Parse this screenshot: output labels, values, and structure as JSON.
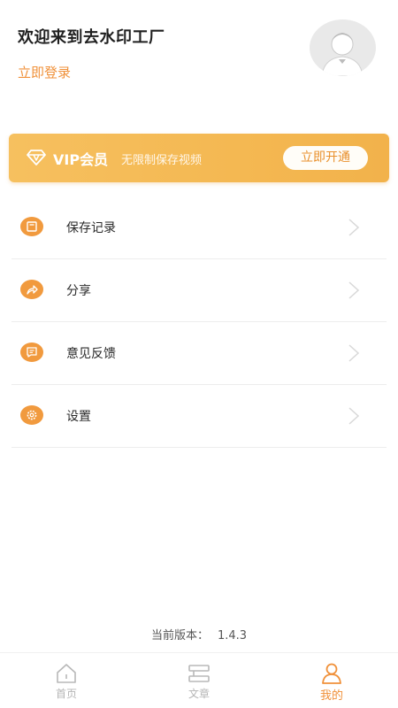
{
  "header": {
    "welcome": "欢迎来到去水印工厂",
    "login_link": "立即登录"
  },
  "vip": {
    "title": "VIP会员",
    "description": "无限制保存视频",
    "button": "立即开通"
  },
  "menu": {
    "items": [
      {
        "label": "保存记录",
        "icon": "save-record-icon"
      },
      {
        "label": "分享",
        "icon": "share-icon"
      },
      {
        "label": "意见反馈",
        "icon": "feedback-icon"
      },
      {
        "label": "设置",
        "icon": "settings-icon"
      }
    ]
  },
  "version": {
    "label": "当前版本：",
    "value": "1.4.3"
  },
  "tabbar": {
    "tabs": [
      {
        "label": "首页",
        "icon": "home-icon",
        "active": false
      },
      {
        "label": "文章",
        "icon": "article-icon",
        "active": false
      },
      {
        "label": "我的",
        "icon": "profile-icon",
        "active": true
      }
    ]
  },
  "colors": {
    "accent": "#f0913a",
    "vip_gradient_start": "#f6c05f",
    "vip_gradient_end": "#f2b24b",
    "tab_inactive": "#b5b5b5"
  }
}
